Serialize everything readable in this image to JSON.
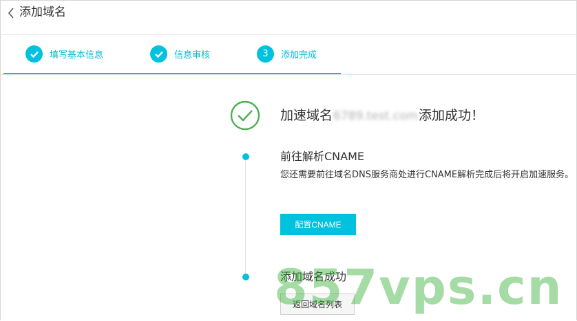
{
  "header": {
    "back_icon": "chevron-left-icon",
    "title": "添加域名"
  },
  "steps": [
    {
      "label": "填写基本信息",
      "status": "done",
      "icon": "check-icon"
    },
    {
      "label": "信息审核",
      "status": "done",
      "icon": "check-icon"
    },
    {
      "label": "添加完成",
      "status": "current",
      "number": "3"
    }
  ],
  "success": {
    "icon": "check-circle-icon",
    "prefix": "加速域名",
    "domain": "6789.test.com",
    "suffix": "添加成功！"
  },
  "sections": [
    {
      "title": "前往解析CNAME",
      "description": "您还需要前往域名DNS服务商处进行CNAME解析完成后将开启加速服务。",
      "button": "配置CNAME"
    },
    {
      "title": "添加域名成功",
      "button": "返回域名列表"
    }
  ],
  "watermark": "857vps.cn",
  "colors": {
    "accent": "#00c1de",
    "success": "#4caf50",
    "text": "#333333"
  }
}
